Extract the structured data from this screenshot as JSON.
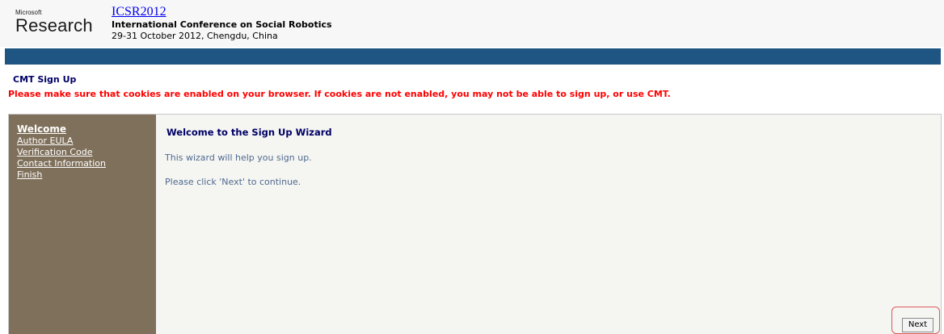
{
  "header": {
    "logo_small": "Microsoft",
    "logo_large": "Research",
    "conference_title": "ICSR2012",
    "conference_name": "International Conference on Social Robotics",
    "conference_dates": "29-31 October 2012, Chengdu, China"
  },
  "page": {
    "heading": "CMT Sign Up",
    "warning": "Please make sure that cookies are enabled on your browser. If cookies are not enabled, you may not be able to sign up, or use CMT."
  },
  "wizard": {
    "steps": [
      {
        "label": "Welcome",
        "active": true
      },
      {
        "label": "Author EULA",
        "active": false
      },
      {
        "label": "Verification Code",
        "active": false
      },
      {
        "label": "Contact Information",
        "active": false
      },
      {
        "label": "Finish",
        "active": false
      }
    ],
    "title": "Welcome to the Sign Up Wizard",
    "line1": "This wizard will help you sign up.",
    "line2": "Please click 'Next' to continue.",
    "next_label": "Next"
  },
  "colors": {
    "header_bar": "#1e5582",
    "sidebar": "#7f705b",
    "warning": "#ff0000",
    "heading": "#000066"
  }
}
